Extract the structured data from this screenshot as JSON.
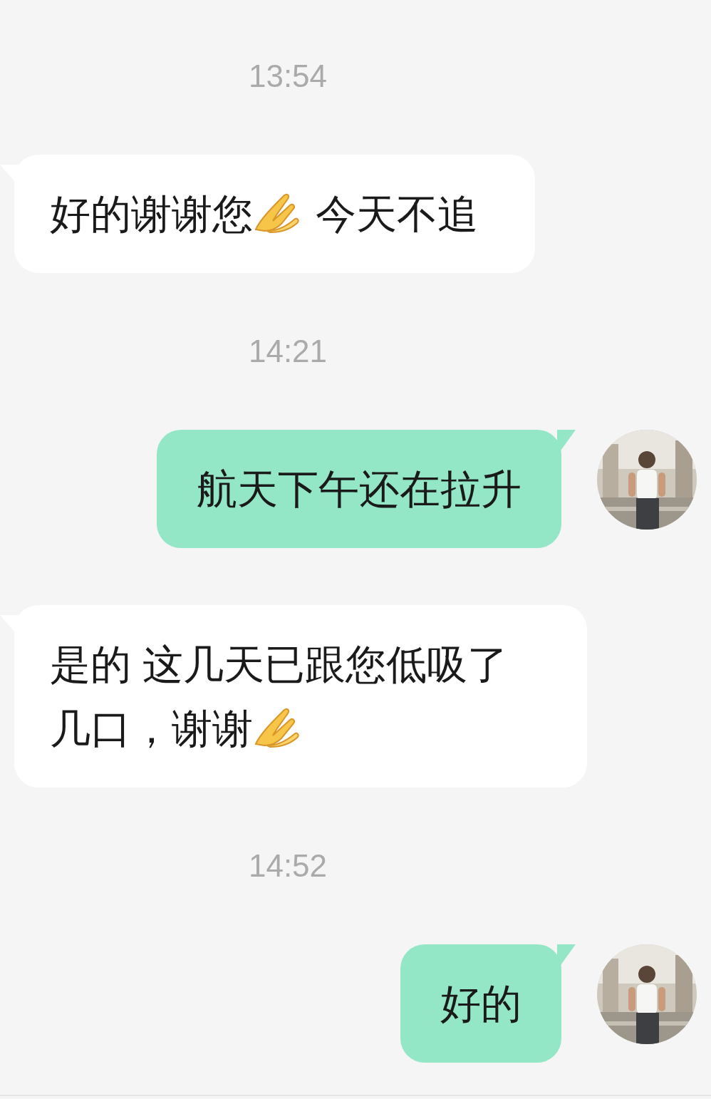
{
  "messages": [
    {
      "kind": "time",
      "text": "13:54"
    },
    {
      "kind": "received",
      "segments": [
        {
          "kind": "text",
          "text": "好的谢谢您"
        },
        {
          "kind": "emoji"
        },
        {
          "kind": "text",
          "text": " 今天不追"
        }
      ]
    },
    {
      "kind": "time",
      "text": "14:21"
    },
    {
      "kind": "sent",
      "segments": [
        {
          "kind": "text",
          "text": "航天下午还在拉升"
        }
      ],
      "avatar": {
        "kind": "picture"
      }
    },
    {
      "kind": "received",
      "segments": [
        {
          "kind": "text",
          "text": "是的 这几天已跟您低吸了几口，谢谢"
        },
        {
          "kind": "emoji"
        }
      ]
    },
    {
      "kind": "time",
      "text": "14:52"
    },
    {
      "kind": "sent",
      "segments": [
        {
          "kind": "text",
          "text": "好的"
        }
      ],
      "avatar": {
        "kind": "picture"
      }
    }
  ]
}
